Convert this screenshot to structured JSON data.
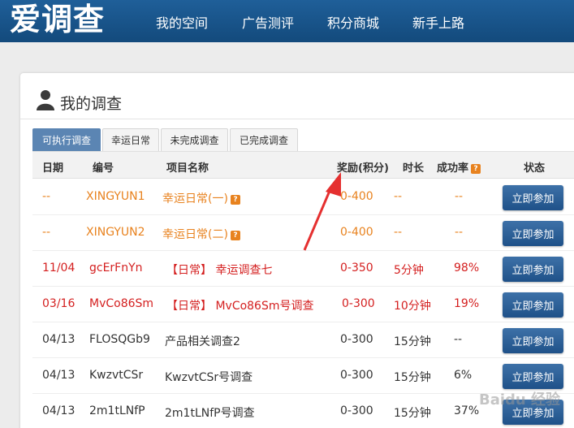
{
  "header": {
    "logo": "爱调查",
    "nav": [
      "我的空间",
      "广告测评",
      "积分商城",
      "新手上路"
    ]
  },
  "panel": {
    "title": "我的调查",
    "tabs": [
      "可执行调查",
      "幸运日常",
      "未完成调查",
      "已完成调查"
    ]
  },
  "table": {
    "headers": [
      "日期",
      "编号",
      "项目名称",
      "奖励(积分)",
      "时长",
      "成功率",
      "状态"
    ],
    "rows": [
      {
        "date": "--",
        "id": "XINGYUN1",
        "name": "幸运日常(一)",
        "reward": "0-400",
        "duration": "--",
        "rate": "--",
        "action": "立即参加"
      },
      {
        "date": "--",
        "id": "XINGYUN2",
        "name": "幸运日常(二)",
        "reward": "0-400",
        "duration": "--",
        "rate": "--",
        "action": "立即参加"
      },
      {
        "date": "11/04",
        "id": "gcErFnYn",
        "name": "【日常】 幸运调查七",
        "reward": "0-350",
        "duration": "5分钟",
        "rate": "98%",
        "action": "立即参加"
      },
      {
        "date": "03/16",
        "id": "MvCo86Sm",
        "name": "【日常】 MvCo86Sm号调查",
        "reward": "0-300",
        "duration": "10分钟",
        "rate": "19%",
        "action": "立即参加"
      },
      {
        "date": "04/13",
        "id": "FLOSQGb9",
        "name": "产品相关调查2",
        "reward": "0-300",
        "duration": "15分钟",
        "rate": "--",
        "action": "立即参加"
      },
      {
        "date": "04/13",
        "id": "KwzvtCSr",
        "name": "KwzvtCSr号调查",
        "reward": "0-300",
        "duration": "15分钟",
        "rate": "6%",
        "action": "立即参加"
      },
      {
        "date": "04/13",
        "id": "2m1tLNfP",
        "name": "2m1tLNfP号调查",
        "reward": "0-300",
        "duration": "15分钟",
        "rate": "37%",
        "action": "立即参加"
      }
    ]
  },
  "watermark": "Baidu 经验",
  "colors": {
    "nav_bg": "#1f5f99",
    "button": "#2a5f97",
    "orange": "#e8821e",
    "red": "#d41f1f",
    "arrow": "#e53030"
  }
}
